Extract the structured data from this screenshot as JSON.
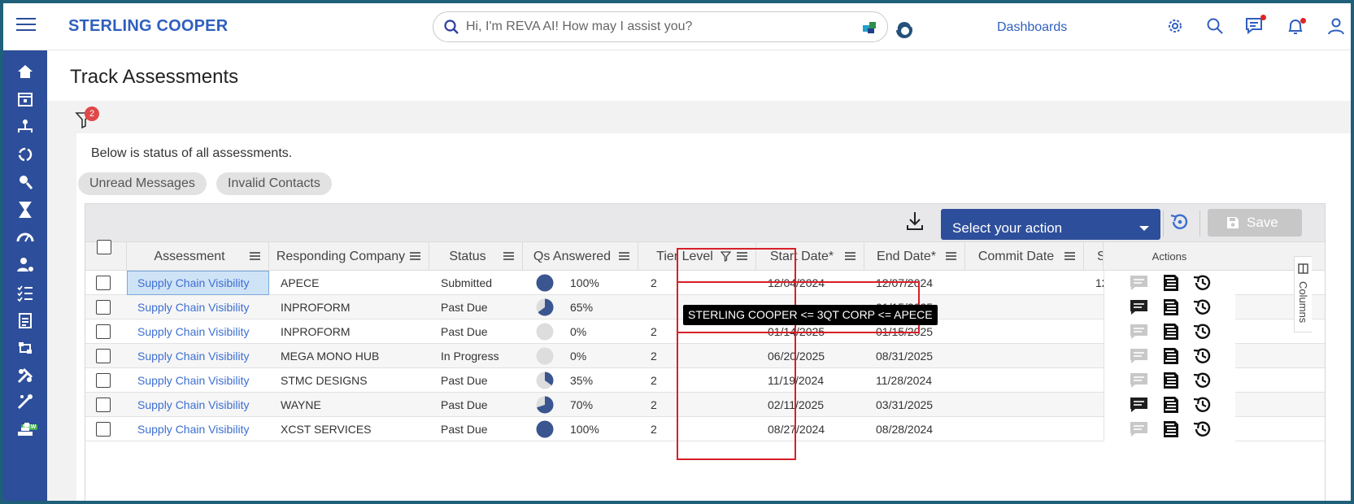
{
  "app": {
    "brand": "STERLING COOPER",
    "search_placeholder": "Hi, I'm REVA AI! How may I assist you?",
    "dashboards_link": "Dashboards"
  },
  "page": {
    "title": "Track Assessments",
    "filter_count": "2",
    "intro": "Below is status of all assessments.",
    "chips": [
      "Unread Messages",
      "Invalid Contacts"
    ]
  },
  "toolbar": {
    "select_action": "Select your action",
    "save_label": "Save"
  },
  "grid": {
    "columns": [
      "Assessment",
      "Responding Company",
      "Status",
      "Qs Answered",
      "Tier Level",
      "Start Date*",
      "End Date*",
      "Commit Date",
      "S",
      "Actions"
    ],
    "columns_tab_label": "Columns",
    "rows": [
      {
        "assessment": "Supply Chain Visibility",
        "company": "APECE",
        "status": "Submitted",
        "answered": "100%",
        "pct": 100,
        "tier": "2",
        "start": "12/04/2024",
        "end": "12/07/2024",
        "extra": "12",
        "msg": "grey"
      },
      {
        "assessment": "Supply Chain Visibility",
        "company": "INPROFORM",
        "status": "Past Due",
        "answered": "65%",
        "pct": 65,
        "tier": "",
        "start": "",
        "end": "01/15/2025",
        "extra": "",
        "msg": "black"
      },
      {
        "assessment": "Supply Chain Visibility",
        "company": "INPROFORM",
        "status": "Past Due",
        "answered": "0%",
        "pct": 0,
        "tier": "2",
        "start": "01/14/2025",
        "end": "01/15/2025",
        "extra": "",
        "msg": "grey"
      },
      {
        "assessment": "Supply Chain Visibility",
        "company": "MEGA MONO HUB",
        "status": "In Progress",
        "answered": "0%",
        "pct": 0,
        "tier": "2",
        "start": "06/20/2025",
        "end": "08/31/2025",
        "extra": "",
        "msg": "grey"
      },
      {
        "assessment": "Supply Chain Visibility",
        "company": "STMC DESIGNS",
        "status": "Past Due",
        "answered": "35%",
        "pct": 35,
        "tier": "2",
        "start": "11/19/2024",
        "end": "11/28/2024",
        "extra": "",
        "msg": "grey"
      },
      {
        "assessment": "Supply Chain Visibility",
        "company": "WAYNE",
        "status": "Past Due",
        "answered": "70%",
        "pct": 70,
        "tier": "2",
        "start": "02/11/2025",
        "end": "03/31/2025",
        "extra": "",
        "msg": "black"
      },
      {
        "assessment": "Supply Chain Visibility",
        "company": "XCST SERVICES",
        "status": "Past Due",
        "answered": "100%",
        "pct": 100,
        "tier": "2",
        "start": "08/27/2024",
        "end": "08/28/2024",
        "extra": "",
        "msg": "grey"
      }
    ]
  },
  "tooltip": "STERLING COOPER <= 3QT CORP <= APECE",
  "colors": {
    "brand": "#2f5fbf",
    "sidebar": "#2d4e9a",
    "highlight": "#d81f26",
    "pie_fill": "#3a5590",
    "pie_empty": "#dddddd"
  }
}
